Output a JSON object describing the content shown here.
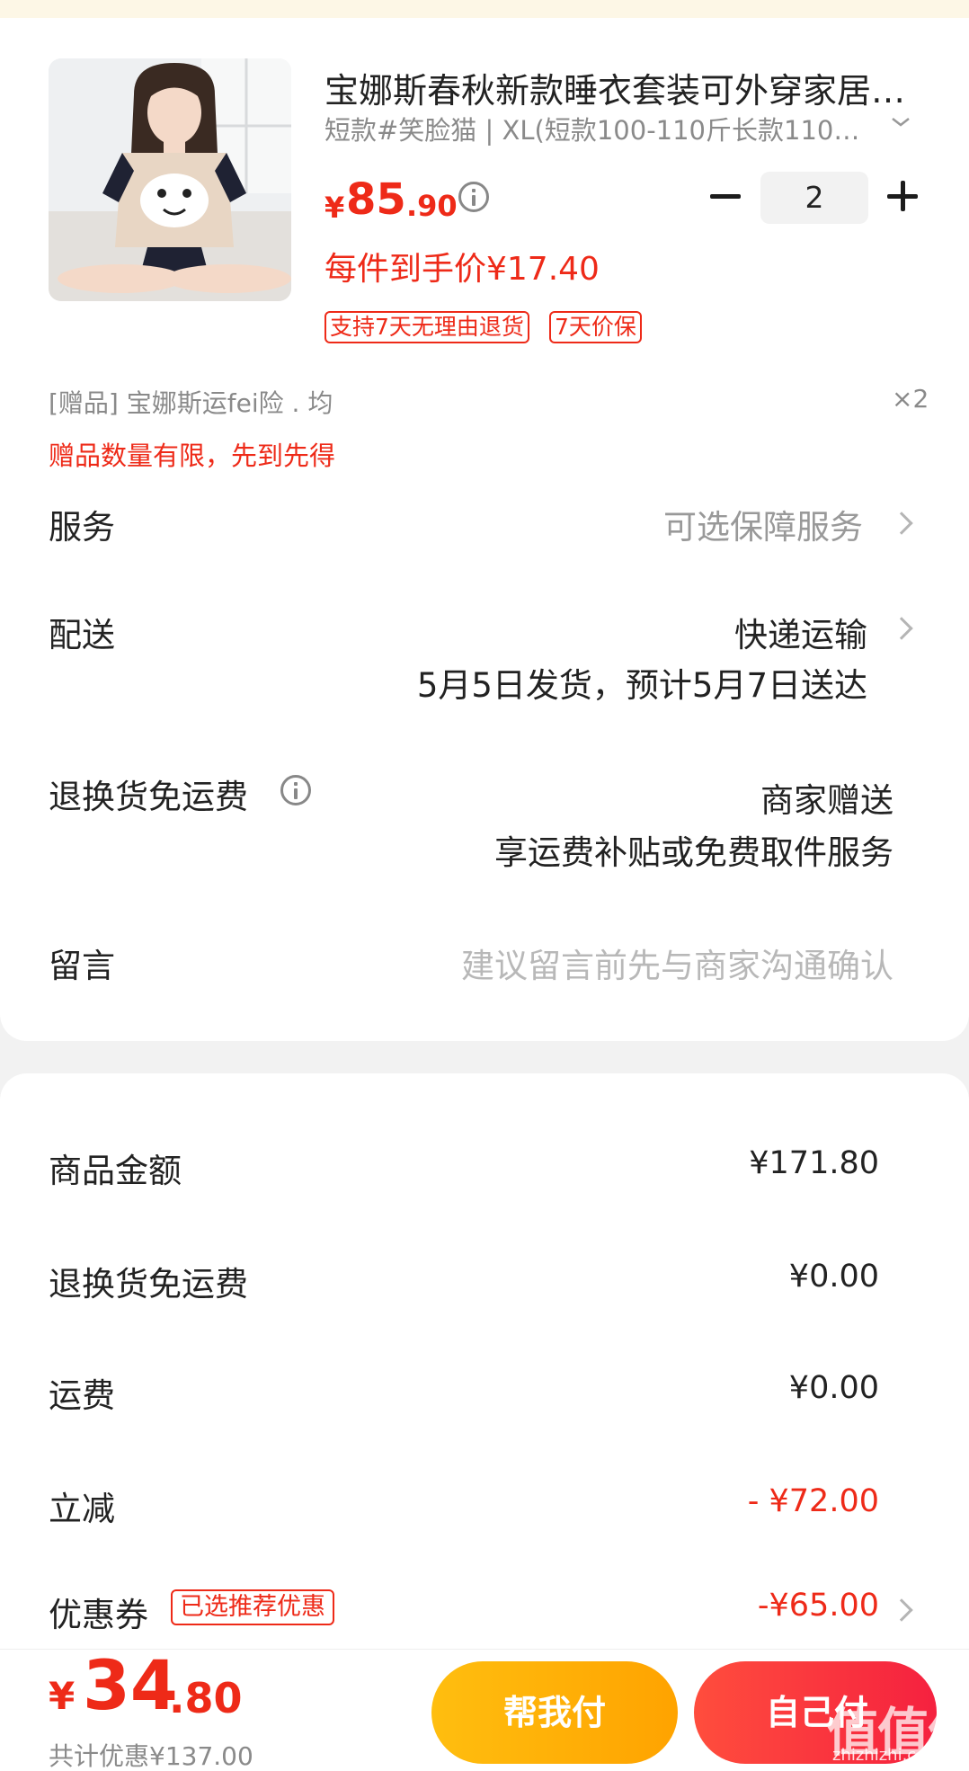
{
  "product": {
    "title": "宝娜斯春秋新款睡衣套装可外穿家居…",
    "spec": "短款#笑脸猫 | XL(短款100-110斤长款110…",
    "price_symbol": "¥",
    "price_int": "85",
    "price_dec": ".90",
    "quantity": "2",
    "unit_price": "每件到手价¥17.40",
    "badges": [
      "支持7天无理由退货",
      "7天价保"
    ]
  },
  "gift": {
    "label": "[赠品]   宝娜斯运fei险 . 均",
    "count": "×2",
    "limit_note": "赠品数量有限，先到先得"
  },
  "rows": {
    "service_label": "服务",
    "service_value": "可选保障服务",
    "delivery_label": "配送",
    "delivery_value": "快递运输",
    "delivery_detail": "5月5日发货，预计5月7日送达",
    "return_label": "退换货免运费",
    "return_value": "商家赠送",
    "return_detail": "享运费补贴或免费取件服务",
    "message_label": "留言",
    "message_placeholder": "建议留言前先与商家沟通确认"
  },
  "fees": {
    "goods_label": "商品金额",
    "goods_value": "¥171.80",
    "return_label": "退换货免运费",
    "return_value": "¥0.00",
    "shipping_label": "运费",
    "shipping_value": "¥0.00",
    "discount_label": "立减",
    "discount_value": "- ¥72.00",
    "coupon_label": "优惠券",
    "coupon_badge": "已选推荐优惠",
    "coupon_value": "-¥65.00"
  },
  "bottom": {
    "total_symbol": "¥",
    "total_int": "34",
    "total_dec": ".80",
    "total_discount": "共计优惠¥137.00",
    "help_pay_label": "帮我付",
    "self_pay_label": "自己付"
  },
  "watermark": {
    "brand": "值值值",
    "url": "zhizhizhi.com"
  },
  "colors": {
    "accent_red": "#ee2a18",
    "help_button": "#ffb000",
    "self_button": "#f5213f"
  }
}
